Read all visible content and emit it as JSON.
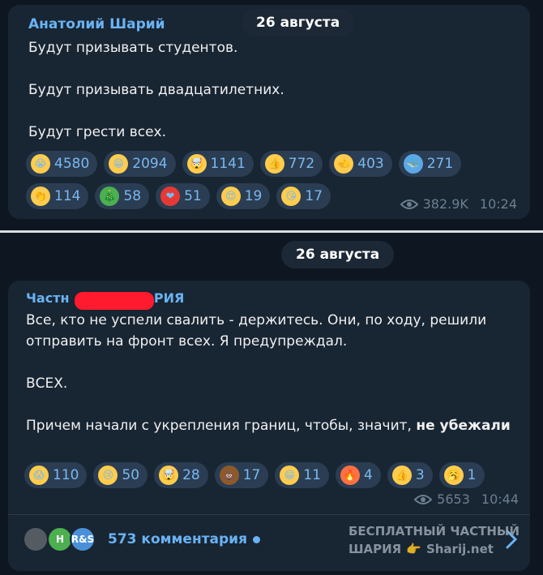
{
  "message1": {
    "sender": "Анатолий Шарий",
    "date": "26 августа",
    "paragraphs": [
      "Будут призывать студентов.",
      "Будут призывать двадцатилетних.",
      "Будут грести всех."
    ],
    "reactions": [
      {
        "icon": "crying-face",
        "emoji": "😭",
        "count": "4580",
        "color": "#ffcc4d"
      },
      {
        "icon": "grinning-face",
        "emoji": "😁",
        "count": "2094",
        "color": "#ffcc4d"
      },
      {
        "icon": "exploding-head",
        "emoji": "🤯",
        "count": "1141",
        "color": "#ffcc4d"
      },
      {
        "icon": "thumbs-up",
        "emoji": "👍",
        "count": "772",
        "color": "#ffcc4d"
      },
      {
        "icon": "pointing-hand",
        "emoji": "🫲",
        "count": "403",
        "color": "#ffcc4d"
      },
      {
        "icon": "whale",
        "emoji": "🐳",
        "count": "271",
        "color": "#5aa9e6"
      },
      {
        "icon": "clapping-hands",
        "emoji": "👏",
        "count": "114",
        "color": "#ffcc4d"
      },
      {
        "icon": "christmas-tree",
        "emoji": "🎄",
        "count": "58",
        "color": "#4caf50"
      },
      {
        "icon": "heart",
        "emoji": "❤",
        "count": "51",
        "color": "#e53935"
      },
      {
        "icon": "heart-eyes",
        "emoji": "😍",
        "count": "19",
        "color": "#ffcc4d"
      },
      {
        "icon": "kissing-face",
        "emoji": "😘",
        "count": "17",
        "color": "#ffcc4d"
      }
    ],
    "views": "382.9K",
    "time": "10:24"
  },
  "message2": {
    "date": "26 августа",
    "sender_start": "Частн",
    "sender_end": "АРИЯ",
    "paragraphs": [
      "Все, кто не успели свалить - держитесь. Они, по ходу, решили отправить на фронт всех. Я предупреждал.",
      "ВСЕХ.",
      "Причем начали с укрепления границ, чтобы, значит,"
    ],
    "bold_tail": "не убежали",
    "reactions": [
      {
        "icon": "screaming-face",
        "emoji": "😱",
        "count": "110",
        "color": "#ffcc4d"
      },
      {
        "icon": "sad-face",
        "emoji": "😢",
        "count": "50",
        "color": "#ffcc4d"
      },
      {
        "icon": "exploding-head",
        "emoji": "🤯",
        "count": "28",
        "color": "#ffcc4d"
      },
      {
        "icon": "poop",
        "emoji": "💩",
        "count": "17",
        "color": "#8d5a2b"
      },
      {
        "icon": "grinning-face",
        "emoji": "😁",
        "count": "11",
        "color": "#ffcc4d"
      },
      {
        "icon": "fire",
        "emoji": "🔥",
        "count": "4",
        "color": "#ff7043"
      },
      {
        "icon": "thumbs-up",
        "emoji": "👍",
        "count": "3",
        "color": "#ffcc4d"
      },
      {
        "icon": "yawning-face",
        "emoji": "🥱",
        "count": "1",
        "color": "#ffcc4d"
      }
    ],
    "views": "5653",
    "time": "10:44"
  },
  "comments": {
    "label": "573 комментария",
    "avatars": [
      {
        "text": "",
        "color": "#555b63"
      },
      {
        "text": "Н",
        "color": "#4caf50"
      },
      {
        "text": "R&S",
        "color": "#4a90d9"
      }
    ]
  },
  "watermark": {
    "line1": "БЕСПЛАТНЫЙ ЧАСТНЫЙ",
    "line2": "ШАРИЯ",
    "site": "Sharij.net"
  },
  "colors": {
    "background": "#0e1621",
    "bubble": "#182533",
    "accent": "#6ab3f3",
    "chip": "#2b3d52"
  }
}
